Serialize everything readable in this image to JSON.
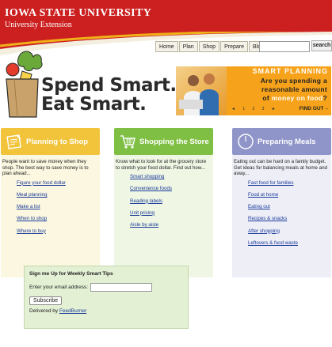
{
  "header": {
    "title": "Iowa State University",
    "subtitle": "University Extension"
  },
  "nav": {
    "items": [
      "Home",
      "Plan",
      "Shop",
      "Prepare",
      "Blog"
    ],
    "search_value": "",
    "search_label": "search"
  },
  "logo": {
    "line1": "Spend Smart.",
    "line2": "Eat Smart."
  },
  "banner": {
    "heading": "SMART PLANNING",
    "q1": "Are you spending a",
    "q2": "reasonable amount",
    "q3_pre": "of ",
    "q3_hl": "money on food",
    "q3_post": "?",
    "pager": "◄ 1 2 3 ►",
    "cta": "FIND OUT→"
  },
  "columns": [
    {
      "title": "Planning to Shop",
      "icon": "notepad-icon",
      "intro": "People want to save money when they shop. The best way to save money is to plan ahead...",
      "links": [
        "Figure your food dollar",
        "Meal planning",
        "Make a list",
        "When to shop",
        "Where to buy"
      ]
    },
    {
      "title": "Shopping the Store",
      "icon": "cart-icon",
      "intro": "Know what to look for at the grocery store to stretch your food dollar. Find out how...",
      "links": [
        "Smart shopping",
        "Convenience foods",
        "Reading labels",
        "Unit pricing",
        "Aisle by aisle"
      ]
    },
    {
      "title": "Preparing Meals",
      "icon": "clock-icon",
      "intro": "Eating out can be hard on a family budget. Get ideas for balancing meals at home and away...",
      "links": [
        "Fast food for families",
        "Food at home",
        "Eating out",
        "Recipes & snacks",
        "After shopping",
        "Leftovers & food waste"
      ]
    }
  ],
  "signup": {
    "heading": "Sign me Up for Weekly Smart Tips",
    "email_label": "Enter your email address:",
    "email_value": "",
    "button": "Subscribe",
    "delivered_prefix": "Delivered by ",
    "delivered_link": "FeedBurner"
  }
}
